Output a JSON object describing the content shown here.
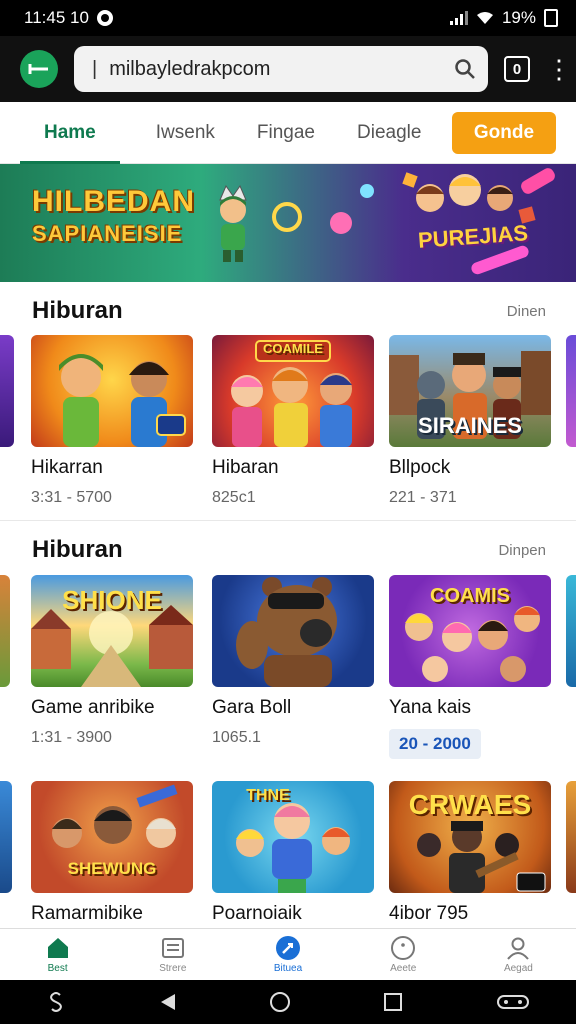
{
  "status_bar": {
    "time": "11:45 10",
    "battery": "19%"
  },
  "browser": {
    "url": "milbayledrakpcom",
    "tab_count": "0"
  },
  "nav_tabs": {
    "items": [
      {
        "label": "Hame"
      },
      {
        "label": "Iwsenk"
      },
      {
        "label": "Fingae"
      },
      {
        "label": "Dieagle"
      }
    ],
    "cta": "Gonde"
  },
  "banner": {
    "title_line1": "HILBEDAN",
    "title_line2": "SAPIANEISIE",
    "logo": "PUREJIAS"
  },
  "sections": [
    {
      "title": "Hiburan",
      "more": "Dinen",
      "cards": [
        {
          "title": "Hikarran",
          "sub": "3:31 - 5700",
          "thumb_label": ""
        },
        {
          "title": "Hibaran",
          "sub": "825c1",
          "thumb_label": "COAMILE"
        },
        {
          "title": "Bllpock",
          "sub": "221 - 371",
          "thumb_label": "SIRAINES"
        }
      ]
    },
    {
      "title": "Hiburan",
      "more": "Dinpen",
      "cards": [
        {
          "title": "Game anribike",
          "sub": "1:31 - 3900",
          "thumb_label": "SHIONE"
        },
        {
          "title": "Gara Boll",
          "sub": "1065.1",
          "thumb_label": ""
        },
        {
          "title": "Yana kais",
          "sub": "20 - 2000",
          "thumb_label": "COAMIS"
        }
      ]
    },
    {
      "title": "",
      "more": "",
      "cards": [
        {
          "title": "Ramarmibike",
          "sub": "",
          "thumb_label": "SHEWUNG"
        },
        {
          "title": "Poarnoiaik",
          "sub": "",
          "thumb_label": "THNE"
        },
        {
          "title": "4ibor 795",
          "sub": "",
          "thumb_label": "CRWAES"
        }
      ]
    }
  ],
  "bottom_nav": [
    {
      "label": "Best",
      "icon": "home-icon"
    },
    {
      "label": "Strere",
      "icon": "list-icon"
    },
    {
      "label": "Bituea",
      "icon": "compass-icon"
    },
    {
      "label": "Aeete",
      "icon": "dots-icon"
    },
    {
      "label": "Aegad",
      "icon": "person-icon"
    }
  ],
  "colors": {
    "accent": "#0f7a4f",
    "cta": "#f5a012",
    "link_blue": "#1a6fd6"
  }
}
